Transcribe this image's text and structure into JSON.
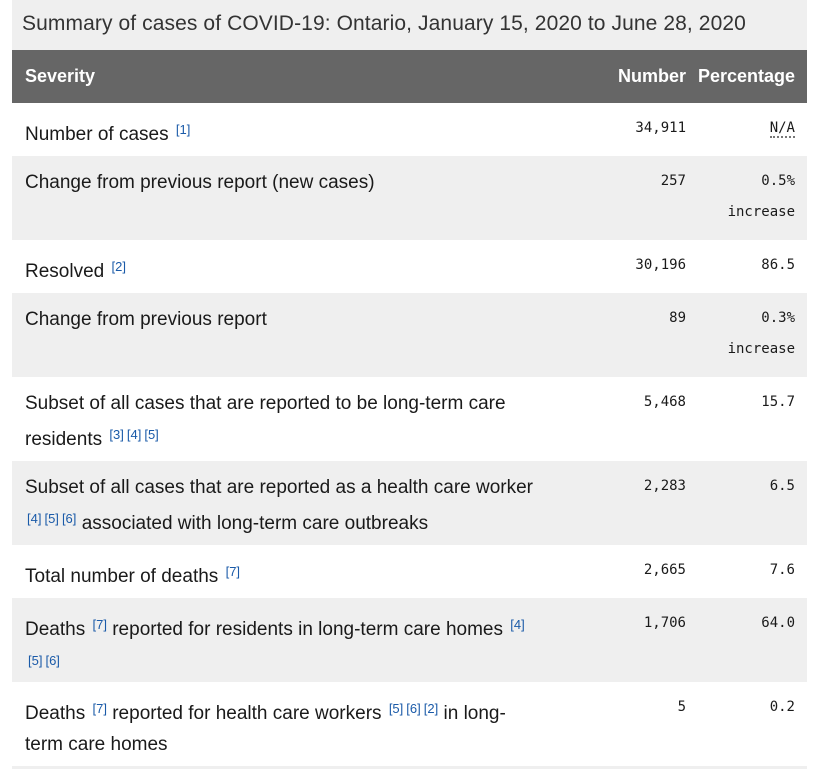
{
  "caption": "Summary of cases of COVID-19: Ontario, January 15, 2020 to June 28, 2020",
  "headers": {
    "severity": "Severity",
    "number": "Number",
    "percentage": "Percentage"
  },
  "rows": [
    {
      "label": "Number of cases",
      "refs": [
        "[1]"
      ],
      "number": "34,911",
      "pct": "N/A",
      "pct_note": ""
    },
    {
      "label": "Change from previous report (new cases)",
      "refs": [],
      "number": "257",
      "pct": "0.5%",
      "pct_note": "increase"
    },
    {
      "label": "Resolved",
      "refs": [
        "[2]"
      ],
      "number": "30,196",
      "pct": "86.5",
      "pct_note": ""
    },
    {
      "label": "Change from previous report",
      "refs": [],
      "number": "89",
      "pct": "0.3%",
      "pct_note": "increase"
    },
    {
      "label": "Subset of all cases that are reported to be long-term care residents",
      "refs": [
        "[3]",
        "[4]",
        "[5]"
      ],
      "number": "5,468",
      "pct": "15.7",
      "pct_note": ""
    },
    {
      "label_a": "Subset of all cases that are reported as a health care worker",
      "refs": [
        "[4]",
        "[5]",
        "[6]"
      ],
      "label_b": "associated with long-term care outbreaks",
      "number": "2,283",
      "pct": "6.5",
      "pct_note": ""
    },
    {
      "label": "Total number of deaths",
      "refs": [
        "[7]"
      ],
      "number": "2,665",
      "pct": "7.6",
      "pct_note": ""
    },
    {
      "label_a": "Deaths",
      "refs_a": [
        "[7]"
      ],
      "label_b": "reported for residents in long-term care homes",
      "refs_b": [
        "[4]",
        "[5]",
        "[6]"
      ],
      "number": "1,706",
      "pct": "64.0",
      "pct_note": ""
    },
    {
      "label_a": "Deaths",
      "refs_a": [
        "[7]"
      ],
      "label_b": "reported for health care workers",
      "refs_b": [
        "[5]",
        "[6]",
        "[2]"
      ],
      "label_c": "in long-term care homes",
      "number": "5",
      "pct": "0.2",
      "pct_note": ""
    }
  ]
}
